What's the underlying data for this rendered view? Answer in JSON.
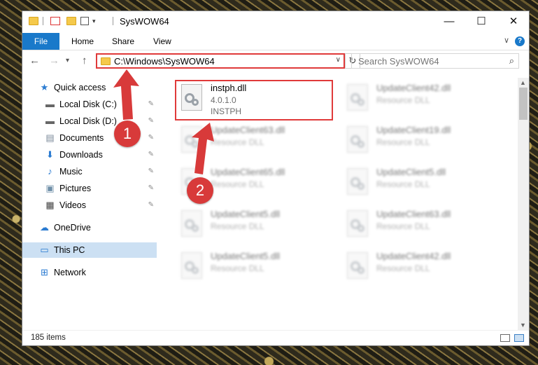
{
  "window": {
    "title": "SysWOW64",
    "minimize_icon": "minimize-icon",
    "maximize_icon": "maximize-icon",
    "close_icon": "close-icon",
    "minimize_glyph": "—",
    "maximize_glyph": "☐",
    "close_glyph": "✕"
  },
  "ribbon": {
    "tabs": [
      "File",
      "Home",
      "Share",
      "View"
    ],
    "accent": "#1979ca",
    "help_glyph": "?",
    "toggle_glyph": "∨"
  },
  "navbar": {
    "back_glyph": "←",
    "forward_glyph": "→",
    "recent_glyph": "▾",
    "up_glyph": "↑",
    "address": "C:\\Windows\\SysWOW64",
    "address_chevron": "∨",
    "refresh_glyph": "↻",
    "search_placeholder": "Search SysWOW64",
    "search_glyph": "⌕"
  },
  "sidebar": {
    "items": [
      {
        "label": "Quick access",
        "icon": "star-icon",
        "glyph": "★",
        "pinned": false
      },
      {
        "label": "Local Disk (C:)",
        "icon": "drive-icon",
        "glyph": "▬",
        "pinned": true
      },
      {
        "label": "Local Disk (D:)",
        "icon": "drive-icon",
        "glyph": "▬",
        "pinned": true
      },
      {
        "label": "Documents",
        "icon": "documents-icon",
        "glyph": "▤",
        "pinned": true
      },
      {
        "label": "Downloads",
        "icon": "download-icon",
        "glyph": "⬇",
        "pinned": true
      },
      {
        "label": "Music",
        "icon": "music-icon",
        "glyph": "♪",
        "pinned": true
      },
      {
        "label": "Pictures",
        "icon": "pictures-icon",
        "glyph": "▣",
        "pinned": true
      },
      {
        "label": "Videos",
        "icon": "videos-icon",
        "glyph": "▦",
        "pinned": true
      },
      {
        "label": "OneDrive",
        "icon": "cloud-icon",
        "glyph": "☁",
        "pinned": false
      },
      {
        "label": "This PC",
        "icon": "computer-icon",
        "glyph": "▭",
        "pinned": false,
        "selected": true
      },
      {
        "label": "Network",
        "icon": "network-icon",
        "glyph": "⊞",
        "pinned": false
      }
    ],
    "pin_glyph": "✎"
  },
  "files": [
    {
      "name": "instph.dll",
      "line2": "4.0.1.0",
      "line3": "INSTPH",
      "highlighted": true
    },
    {
      "name": "UpdateClient42.dll",
      "line2": "Resource DLL"
    },
    {
      "name": "UpdateClient63.dll",
      "line2": "Resource DLL"
    },
    {
      "name": "UpdateClient19.dll",
      "line2": "Resource DLL"
    },
    {
      "name": "UpdateClient65.dll",
      "line2": "Resource DLL"
    },
    {
      "name": "UpdateClient5.dll",
      "line2": "Resource DLL"
    },
    {
      "name": "UpdateClient5.dll",
      "line2": "Resource DLL"
    },
    {
      "name": "UpdateClient63.dll",
      "line2": "Resource DLL"
    },
    {
      "name": "UpdateClient5.dll",
      "line2": "Resource DLL"
    },
    {
      "name": "UpdateClient42.dll",
      "line2": "Resource DLL"
    }
  ],
  "status": {
    "item_count": "185 items"
  },
  "scrollbar": {
    "up_glyph": "▲",
    "down_glyph": "▼"
  },
  "annotations": {
    "step1": "1",
    "step2": "2",
    "color": "#d83a3a"
  }
}
